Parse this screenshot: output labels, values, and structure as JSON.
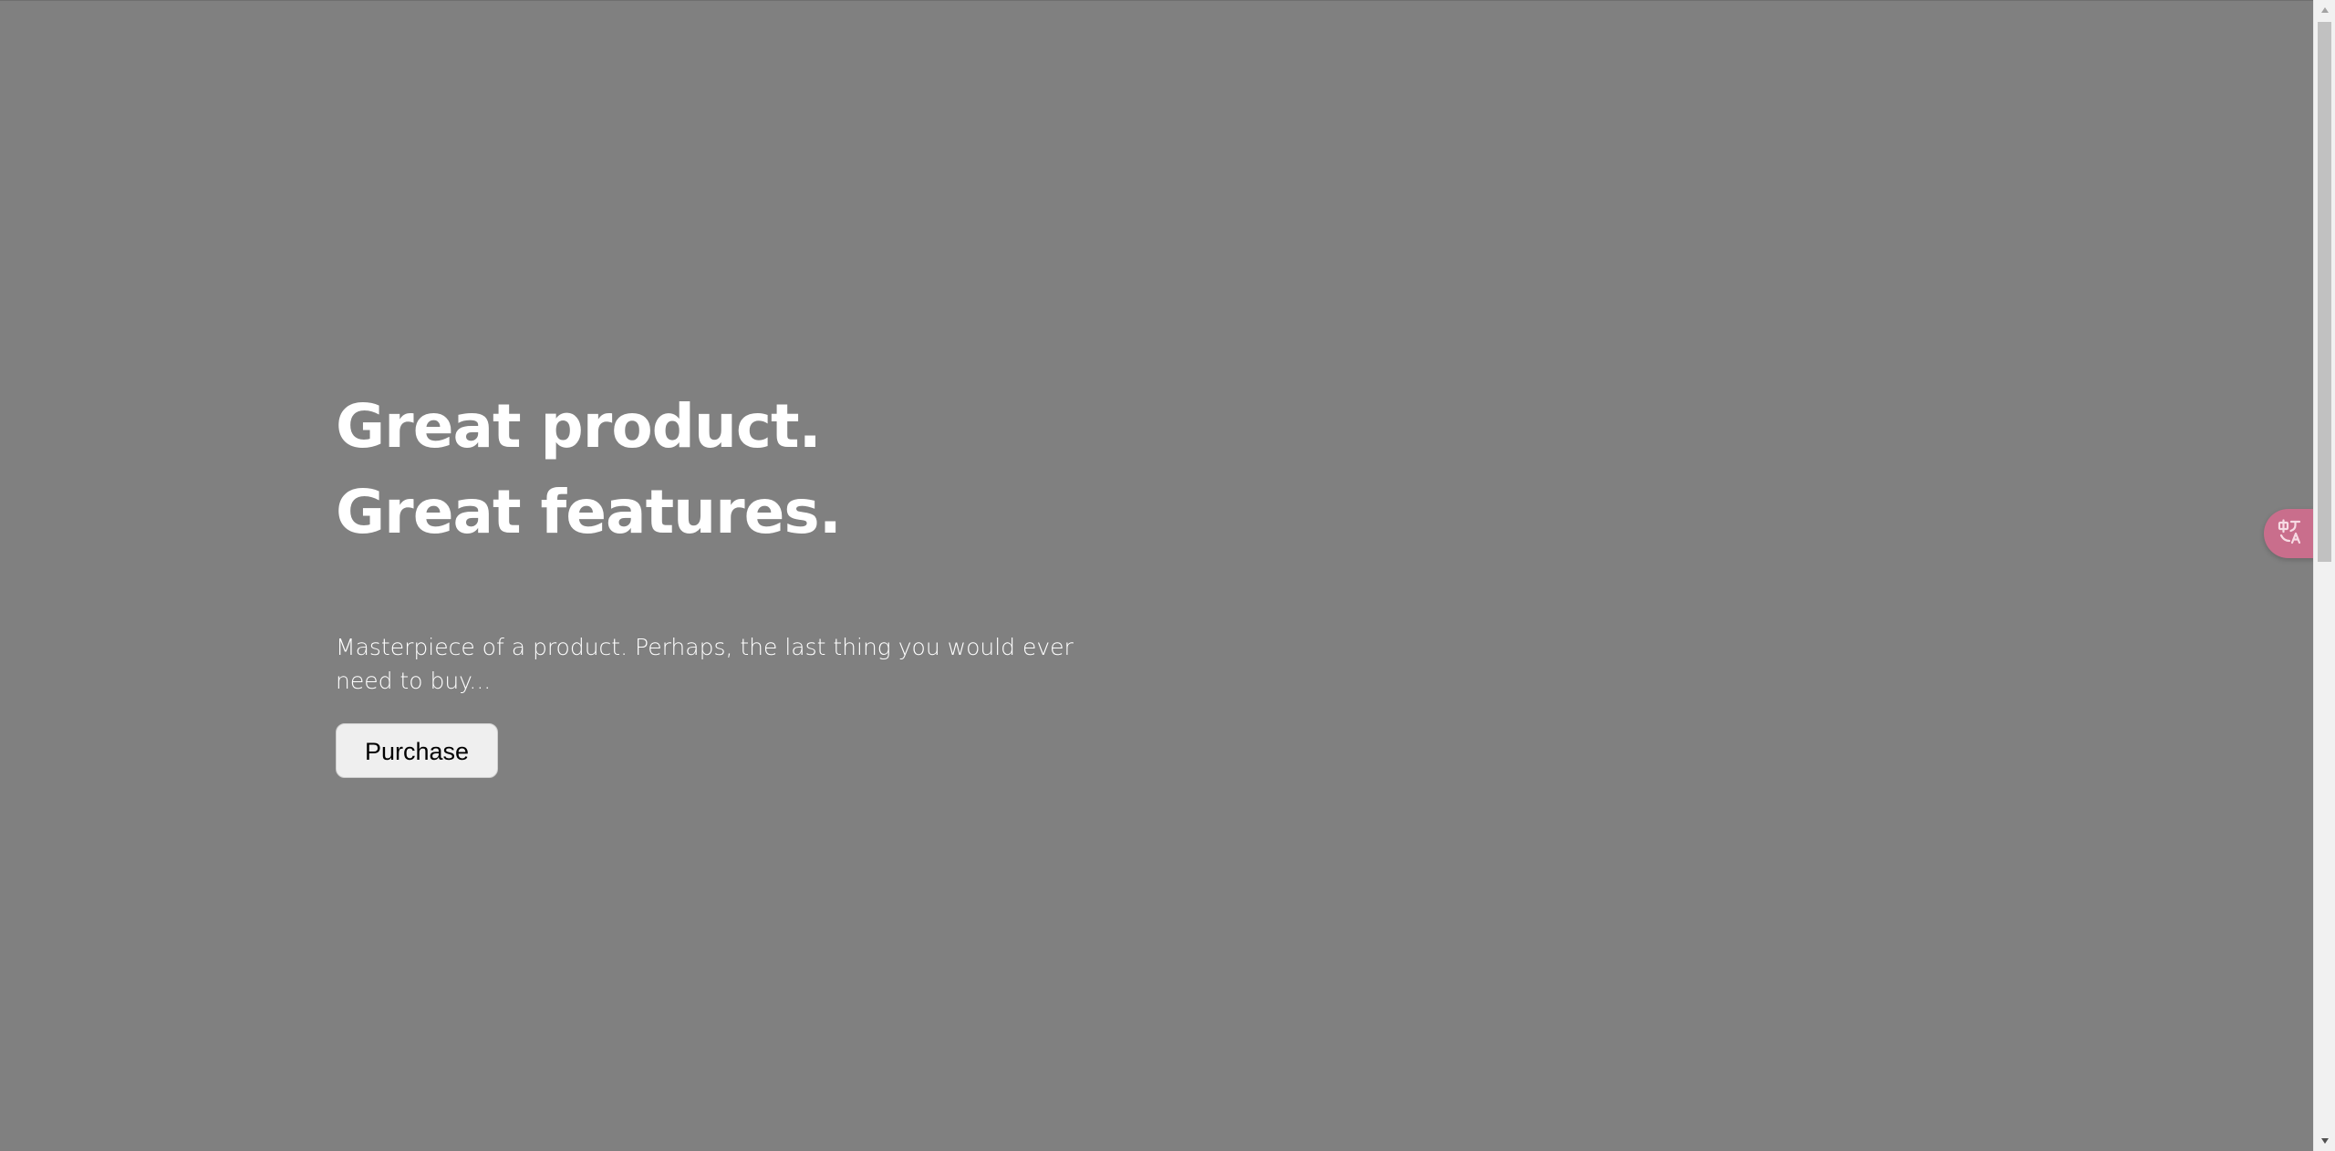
{
  "hero": {
    "title_line1": "Great product.",
    "title_line2": "Great features.",
    "description": "Masterpiece of a product. Perhaps, the last thing you would ever need to buy...",
    "purchase_label": "Purchase"
  },
  "widgets": {
    "translate_icon": "translate-icon"
  },
  "colors": {
    "page_background": "#808080",
    "text": "#ffffff",
    "button_background": "#efefef",
    "translate_badge": "#c96e8c"
  }
}
